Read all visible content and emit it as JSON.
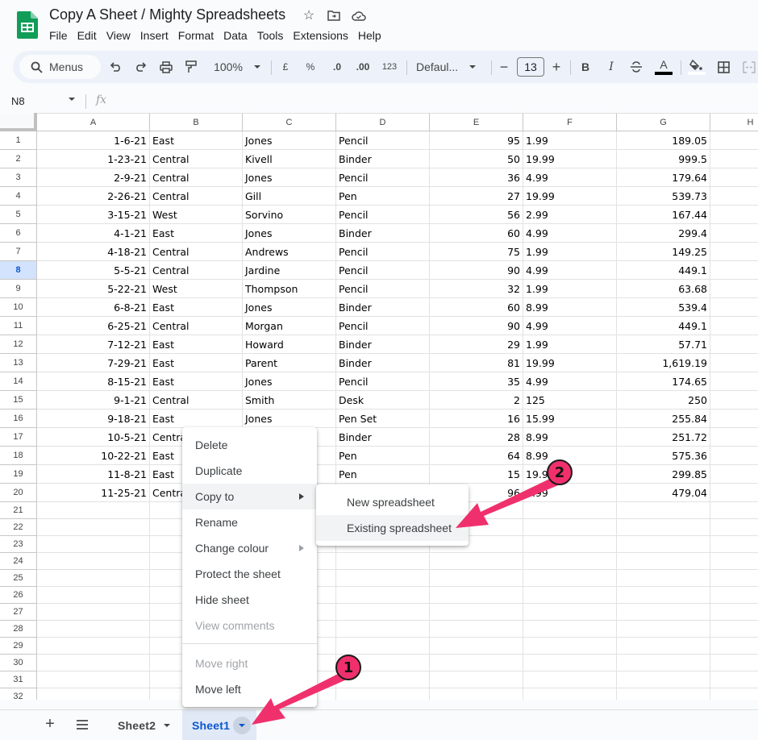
{
  "app": {
    "title": "Copy A Sheet / Mighty Spreadsheets",
    "title_icons": [
      "star-icon",
      "move-to-folder-icon",
      "cloud-saved-icon"
    ],
    "menubar": [
      "File",
      "Edit",
      "View",
      "Insert",
      "Format",
      "Data",
      "Tools",
      "Extensions",
      "Help"
    ]
  },
  "toolbar": {
    "search_label": "Menus",
    "zoom": "100%",
    "currency": "£",
    "percent": "%",
    "decrease_decimal": ".0",
    "increase_decimal": ".00",
    "number_format": "123",
    "font": "Defaul...",
    "font_size": "13",
    "bold": "B",
    "italic": "I",
    "text_color_glyph": "A",
    "colors": {
      "text_color": "#000000",
      "fill_color": "#ffffff",
      "accent": "#0b57d0",
      "annotation": "#f0306c"
    }
  },
  "formula_bar": {
    "name_box": "N8",
    "fx_label": "fx",
    "formula": ""
  },
  "grid": {
    "columns": [
      "A",
      "B",
      "C",
      "D",
      "E",
      "F",
      "G",
      "H"
    ],
    "selected_row": 8,
    "rows": [
      {
        "n": "1",
        "cells": [
          "1-6-21",
          "East",
          "Jones",
          "Pencil",
          "95",
          "1.99",
          "189.05"
        ]
      },
      {
        "n": "2",
        "cells": [
          "1-23-21",
          "Central",
          "Kivell",
          "Binder",
          "50",
          "19.99",
          "999.5"
        ]
      },
      {
        "n": "3",
        "cells": [
          "2-9-21",
          "Central",
          "Jones",
          "Pencil",
          "36",
          "4.99",
          "179.64"
        ]
      },
      {
        "n": "4",
        "cells": [
          "2-26-21",
          "Central",
          "Gill",
          "Pen",
          "27",
          "19.99",
          "539.73"
        ]
      },
      {
        "n": "5",
        "cells": [
          "3-15-21",
          "West",
          "Sorvino",
          "Pencil",
          "56",
          "2.99",
          "167.44"
        ]
      },
      {
        "n": "6",
        "cells": [
          "4-1-21",
          "East",
          "Jones",
          "Binder",
          "60",
          "4.99",
          "299.4"
        ]
      },
      {
        "n": "7",
        "cells": [
          "4-18-21",
          "Central",
          "Andrews",
          "Pencil",
          "75",
          "1.99",
          "149.25"
        ]
      },
      {
        "n": "8",
        "cells": [
          "5-5-21",
          "Central",
          "Jardine",
          "Pencil",
          "90",
          "4.99",
          "449.1"
        ]
      },
      {
        "n": "9",
        "cells": [
          "5-22-21",
          "West",
          "Thompson",
          "Pencil",
          "32",
          "1.99",
          "63.68"
        ]
      },
      {
        "n": "10",
        "cells": [
          "6-8-21",
          "East",
          "Jones",
          "Binder",
          "60",
          "8.99",
          "539.4"
        ]
      },
      {
        "n": "11",
        "cells": [
          "6-25-21",
          "Central",
          "Morgan",
          "Pencil",
          "90",
          "4.99",
          "449.1"
        ]
      },
      {
        "n": "12",
        "cells": [
          "7-12-21",
          "East",
          "Howard",
          "Binder",
          "29",
          "1.99",
          "57.71"
        ]
      },
      {
        "n": "13",
        "cells": [
          "7-29-21",
          "East",
          "Parent",
          "Binder",
          "81",
          "19.99",
          "1,619.19"
        ]
      },
      {
        "n": "14",
        "cells": [
          "8-15-21",
          "East",
          "Jones",
          "Pencil",
          "35",
          "4.99",
          "174.65"
        ]
      },
      {
        "n": "15",
        "cells": [
          "9-1-21",
          "Central",
          "Smith",
          "Desk",
          "2",
          "125",
          "250"
        ]
      },
      {
        "n": "16",
        "cells": [
          "9-18-21",
          "East",
          "Jones",
          "Pen Set",
          "16",
          "15.99",
          "255.84"
        ]
      },
      {
        "n": "17",
        "cells": [
          "10-5-21",
          "Central",
          "",
          "Binder",
          "28",
          "8.99",
          "251.72"
        ]
      },
      {
        "n": "18",
        "cells": [
          "10-22-21",
          "East",
          "",
          "Pen",
          "64",
          "8.99",
          "575.36"
        ]
      },
      {
        "n": "19",
        "cells": [
          "11-8-21",
          "East",
          "",
          "Pen",
          "15",
          "19.99",
          "299.85"
        ]
      },
      {
        "n": "20",
        "cells": [
          "11-25-21",
          "Central",
          "",
          "",
          "96",
          "4.99",
          "479.04"
        ]
      }
    ],
    "empty_rows": [
      "21",
      "22",
      "23",
      "24",
      "25",
      "26",
      "27",
      "28",
      "29",
      "30",
      "31",
      "32"
    ]
  },
  "context_menu": {
    "items": [
      {
        "label": "Delete"
      },
      {
        "label": "Duplicate"
      },
      {
        "label": "Copy to",
        "submenu": true,
        "hover": true
      },
      {
        "label": "Rename"
      },
      {
        "label": "Change colour",
        "submenu": true
      },
      {
        "label": "Protect the sheet"
      },
      {
        "label": "Hide sheet"
      },
      {
        "label": "View comments",
        "disabled": true
      },
      {
        "separator": true
      },
      {
        "label": "Move right",
        "disabled": true
      },
      {
        "label": "Move left"
      }
    ],
    "submenu": {
      "items": [
        {
          "label": "New spreadsheet"
        },
        {
          "label": "Existing spreadsheet",
          "hover": true
        }
      ]
    }
  },
  "sheet_tabs": {
    "tabs": [
      {
        "label": "Sheet2",
        "active": false
      },
      {
        "label": "Sheet1",
        "active": true
      }
    ]
  },
  "annotations": [
    {
      "label": "1",
      "target": "Sheet1 tab menu arrow"
    },
    {
      "label": "2",
      "target": "Existing spreadsheet"
    }
  ]
}
